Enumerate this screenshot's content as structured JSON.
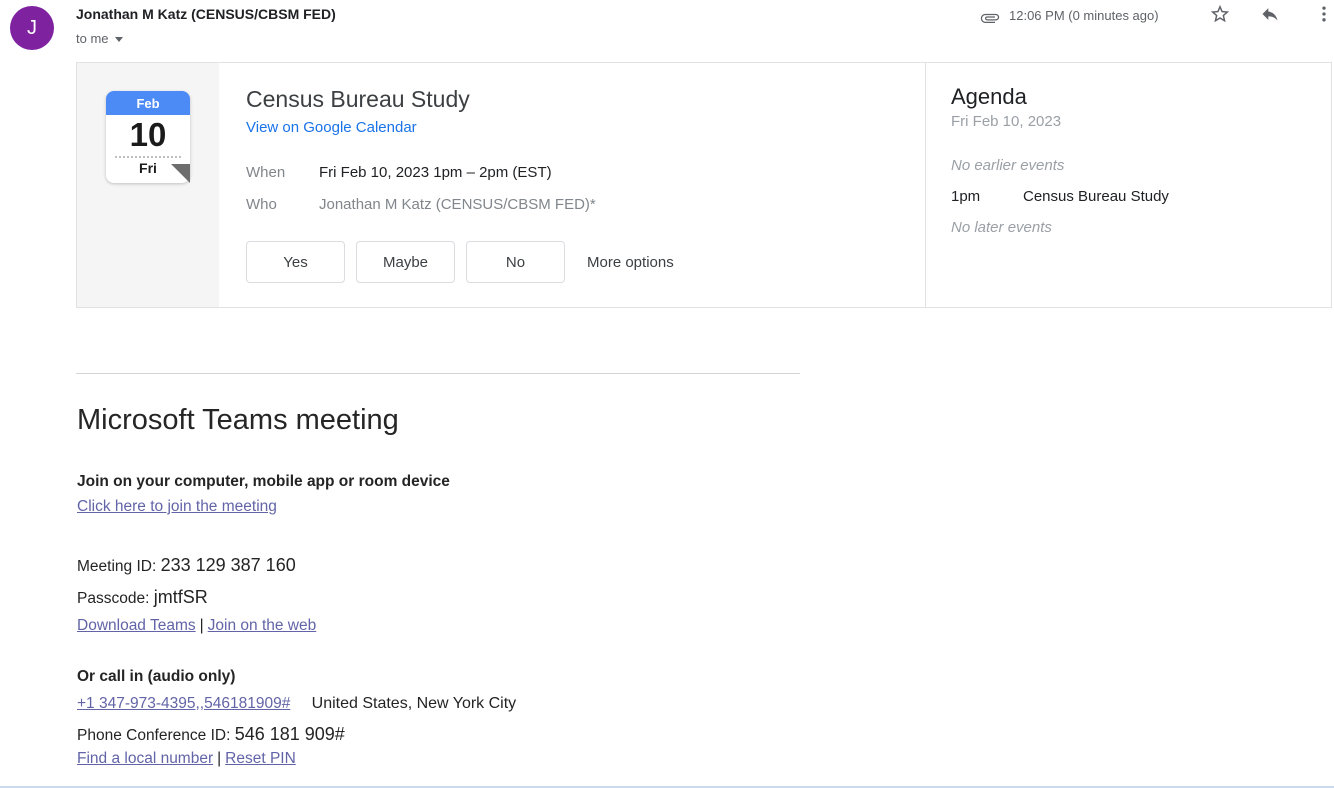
{
  "colors": {
    "accent_blue": "#1a73e8",
    "calendar_blue": "#4c8bf5",
    "teams_purple": "#6264a7",
    "avatar_purple": "#7e22a0"
  },
  "header": {
    "avatar_letter": "J",
    "sender": "Jonathan M Katz (CENSUS/CBSM FED)",
    "recipient": "to me",
    "timestamp": "12:06 PM (0 minutes ago)"
  },
  "invite": {
    "calendar": {
      "month": "Feb",
      "day": "10",
      "weekday": "Fri"
    },
    "title": "Census Bureau Study",
    "view_link": "View on Google Calendar",
    "when_label": "When",
    "when_value": "Fri Feb 10, 2023 1pm – 2pm (EST)",
    "who_label": "Who",
    "who_value": "Jonathan M Katz (CENSUS/CBSM FED)*",
    "rsvp": {
      "yes": "Yes",
      "maybe": "Maybe",
      "no": "No",
      "more": "More options"
    }
  },
  "agenda": {
    "title": "Agenda",
    "date": "Fri Feb 10, 2023",
    "no_earlier": "No earlier events",
    "event_time": "1pm",
    "event_title": "Census Bureau Study",
    "no_later": "No later events"
  },
  "teams": {
    "heading": "Microsoft Teams meeting",
    "join_heading": "Join on your computer, mobile app or room device",
    "join_link": "Click here to join the meeting",
    "meeting_id_label": "Meeting ID:",
    "meeting_id": "233 129 387 160",
    "passcode_label": "Passcode:",
    "passcode": "jmtfSR",
    "download_link": "Download Teams",
    "separator": "|",
    "web_link": "Join on the web",
    "call_heading": "Or call in (audio only)",
    "phone_link": "+1 347-973-4395,,546181909#",
    "phone_location": "United States, New York City",
    "conference_id_label": "Phone Conference ID:",
    "conference_id": "546 181 909#",
    "local_number_link": "Find a local number",
    "reset_pin_link": "Reset PIN"
  }
}
